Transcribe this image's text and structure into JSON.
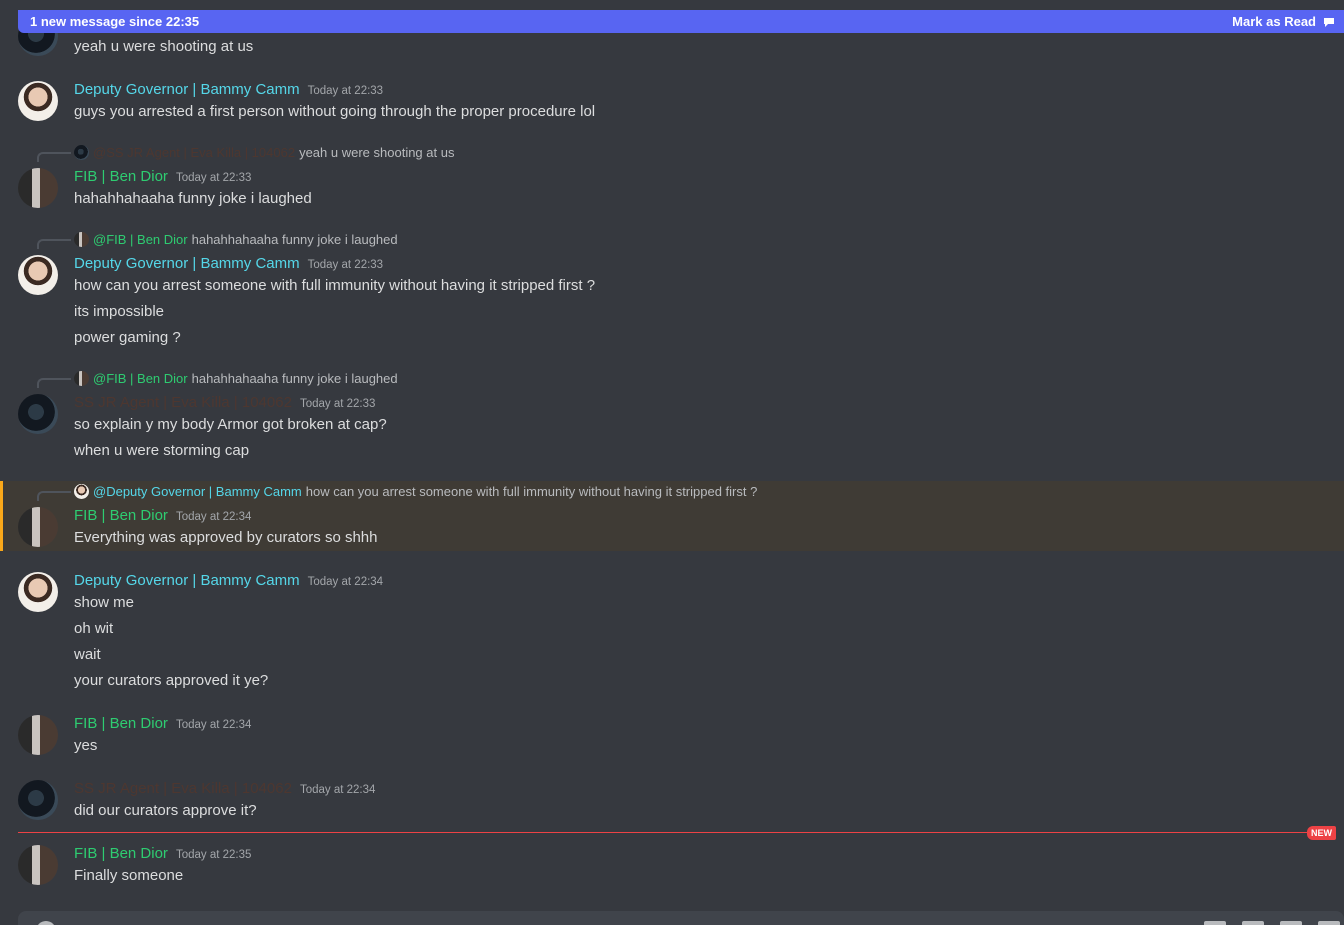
{
  "banner": {
    "text": "1 new message since 22:35",
    "action": "Mark as Read",
    "icon": "mark-read-icon"
  },
  "messages": [
    {
      "line": "yeah u were shooting at us"
    },
    {
      "author": "Deputy Governor | Bammy Camm",
      "time": "Today at 22:33",
      "lines": [
        "guys you arrested a first person without going through the proper procedure lol"
      ]
    },
    {
      "reply": {
        "name": "@SS JR Agent | Eva Killa | 104062",
        "text": "yeah u were shooting at us"
      },
      "author": "FIB | Ben Dior",
      "time": "Today at 22:33",
      "lines": [
        "hahahhahaaha funny joke i laughed"
      ]
    },
    {
      "reply": {
        "name": "@FIB | Ben Dior",
        "text": "hahahhahaaha funny joke i laughed"
      },
      "author": "Deputy Governor | Bammy Camm",
      "time": "Today at 22:33",
      "lines": [
        "how can you arrest someone with full immunity without having it stripped first ?",
        "its impossible",
        "power gaming ?"
      ]
    },
    {
      "reply": {
        "name": "@FIB | Ben Dior",
        "text": "hahahhahaaha funny joke i laughed"
      },
      "author": "SS JR Agent | Eva Killa | 104062",
      "time": "Today at 22:33",
      "lines": [
        "so explain y my body Armor got broken at cap?",
        "when u were storming cap"
      ]
    },
    {
      "reply": {
        "name": "@Deputy Governor | Bammy Camm",
        "text": "how can you arrest someone with full immunity without having it stripped first ?"
      },
      "author": "FIB | Ben Dior",
      "time": "Today at 22:34",
      "lines": [
        "Everything was approved by curators so shhh"
      ]
    },
    {
      "author": "Deputy Governor | Bammy Camm",
      "time": "Today at 22:34",
      "lines": [
        "show me",
        "oh wit",
        "wait",
        "your curators approved it ye?"
      ]
    },
    {
      "author": "FIB | Ben Dior",
      "time": "Today at 22:34",
      "lines": [
        "yes"
      ]
    },
    {
      "author": "SS JR Agent | Eva Killa | 104062",
      "time": "Today at 22:34",
      "lines": [
        "did our curators approve it?"
      ]
    },
    {
      "author": "FIB | Ben Dior",
      "time": "Today at 22:35",
      "lines": [
        "Finally someone"
      ]
    }
  ],
  "divider": {
    "label": "NEW"
  },
  "colors": {
    "banner": "#5865f2",
    "governor": "#55d7e9",
    "fib": "#2ecc71",
    "agent": "#4d3730",
    "highlight_border": "#faa81a",
    "new": "#ed4245"
  }
}
